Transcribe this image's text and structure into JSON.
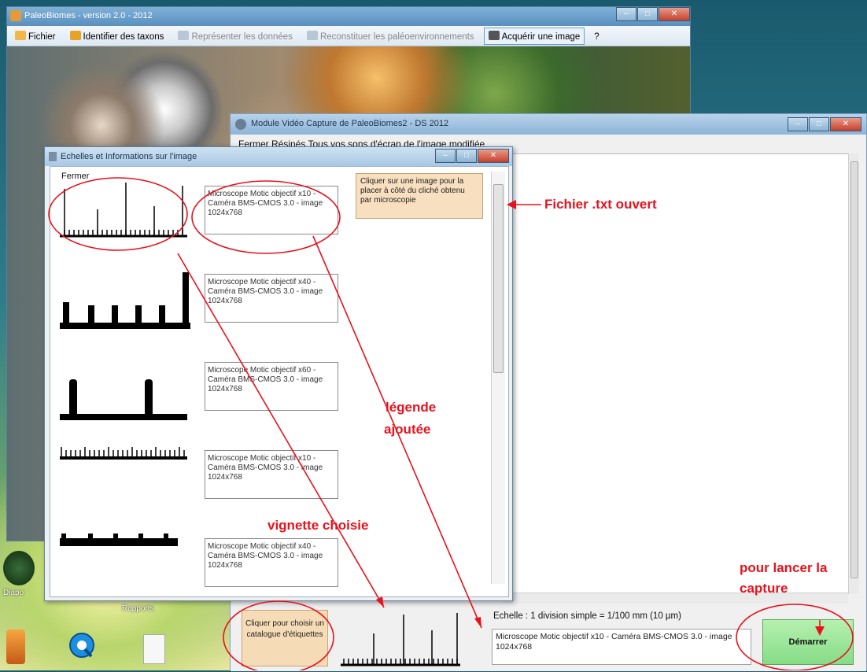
{
  "main_window": {
    "title": "PaleoBiomes - version 2.0 - 2012",
    "menu": [
      {
        "label": "Fichier",
        "icon": "folder-icon",
        "color": "#f1b74a"
      },
      {
        "label": "Identifier des taxons",
        "icon": "book-icon",
        "color": "#e7a228"
      },
      {
        "label": "Représenter les données",
        "icon": "chart-icon",
        "color": "#b7c7d6",
        "disabled": true
      },
      {
        "label": "Reconstituer les paléoenvironnements",
        "icon": "grid-icon",
        "color": "#b7c7d6",
        "disabled": true
      },
      {
        "label": "Acquérir une image",
        "icon": "microscope-icon",
        "color": "#555555"
      },
      {
        "label": "?",
        "icon": "",
        "color": ""
      }
    ]
  },
  "capture_window": {
    "title": "Module Vidéo Capture de PaleoBiomes2 - DS 2012",
    "menu": "Fermer     Résinés     Tous vos sons d'écran de l'image modifiée",
    "catalog_button": "Cliquer pour choisir un catalogue d'étiquettes",
    "scale_text": "Echelle   : 1 division simple = 1/100 mm (10 µm)",
    "legend_text": "Microscope Motic objectif x10 - Caméra BMS-CMOS 3.0 - image 1024x768",
    "start_button": "Démarrer"
  },
  "scales_window": {
    "title": "Echelles et Informations sur l'image",
    "close_menu": "Fermer",
    "hint": "Cliquer sur une image pour la placer à côté du cliché obtenu par microscopie",
    "items": [
      {
        "description": "Microscope Motic objectif x10 - Caméra BMS-CMOS 3.0 - image 1024x768"
      },
      {
        "description": "Microscope Motic objectif x40 - Caméra BMS-CMOS 3.0 - image 1024x768"
      },
      {
        "description": "Microscope Motic objectif x60 - Caméra BMS-CMOS 3.0 - image 1024x768"
      },
      {
        "description": "Microscope Motic objectif x10 - Caméra BMS-CMOS 3.0 - image 1024x768"
      },
      {
        "description": "Microscope Motic objectif x40 - Caméra BMS-CMOS 3.0 - image 1024x768"
      }
    ]
  },
  "desktop": {
    "labels": [
      "Diapo",
      "Rapports"
    ]
  },
  "annotations": {
    "file_opened": "Fichier .txt ouvert",
    "legend_added_1": "légende",
    "legend_added_2": "ajoutée",
    "chosen_thumbnail": "vignette choisie",
    "launch_capture_1": "pour lancer la",
    "launch_capture_2": "capture",
    "color": "#e8111c"
  }
}
